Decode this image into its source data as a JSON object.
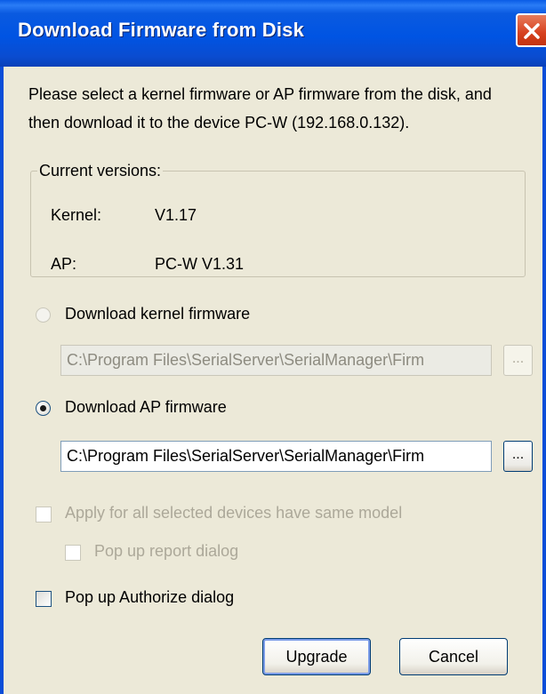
{
  "window": {
    "title": "Download Firmware from Disk",
    "close_label": "✕"
  },
  "description": "Please select a kernel firmware or AP firmware from the disk, and then download it to the device PC-W (192.168.0.132).",
  "versions": {
    "legend": "Current versions:",
    "kernel_label": "Kernel:",
    "kernel_value": "V1.17",
    "ap_label": "AP:",
    "ap_value": "PC-W V1.31"
  },
  "kernel_option": {
    "label": "Download kernel firmware",
    "selected": false,
    "path": "C:\\Program Files\\SerialServer\\SerialManager\\Firm",
    "browse_label": "..."
  },
  "ap_option": {
    "label": "Download AP firmware",
    "selected": true,
    "path": "C:\\Program Files\\SerialServer\\SerialManager\\Firm",
    "browse_label": "..."
  },
  "options": {
    "apply_all_label": "Apply for all selected devices have same model",
    "apply_all_checked": false,
    "popup_report_label": "Pop up report dialog",
    "popup_report_checked": false,
    "popup_authorize_label": "Pop up Authorize dialog",
    "popup_authorize_checked": false
  },
  "buttons": {
    "upgrade": "Upgrade",
    "cancel": "Cancel"
  },
  "colors": {
    "titlebar": "#0054e3",
    "dialog_bg": "#ece9d8",
    "close_button": "#d6401e"
  }
}
